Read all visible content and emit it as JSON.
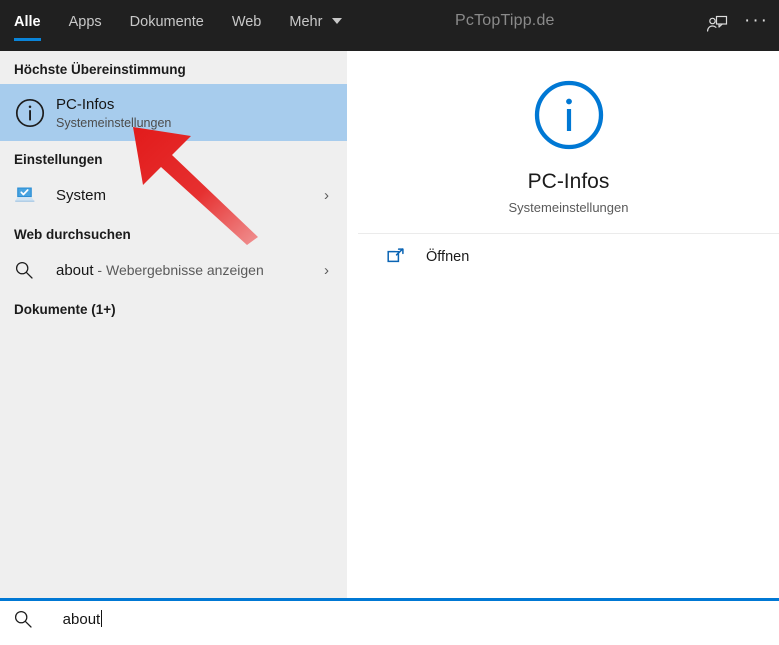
{
  "window": {
    "watermark": "PcTopTipp.de"
  },
  "topbar": {
    "tabs": [
      {
        "label": "Alle",
        "active": true
      },
      {
        "label": "Apps",
        "active": false
      },
      {
        "label": "Dokumente",
        "active": false
      },
      {
        "label": "Web",
        "active": false
      },
      {
        "label": "Mehr",
        "active": false,
        "has_caret": true
      }
    ],
    "feedback_icon": "person-feedback-icon",
    "more_icon": "ellipsis-icon",
    "background_color": "#202020",
    "accent_color": "#0a84d8"
  },
  "sidebar": {
    "best_match_header": "Höchste Übereinstimmung",
    "best_match": {
      "title": "PC-Infos",
      "subtitle": "Systemeinstellungen",
      "icon": "info-circle-icon",
      "selected": true,
      "highlight_color": "#a7cced"
    },
    "settings_header": "Einstellungen",
    "settings_items": [
      {
        "label": "System",
        "icon": "system-monitor-icon",
        "chevron": "›"
      }
    ],
    "web_header": "Web durchsuchen",
    "web_items": [
      {
        "query": "about",
        "suffix": " - Webergebnisse anzeigen",
        "icon": "search-icon",
        "chevron": "›"
      }
    ],
    "documents_header": "Dokumente (1+)",
    "background_color": "#efefef"
  },
  "detail": {
    "icon": "info-circle-icon-large",
    "icon_color": "#0078d4",
    "title": "PC-Infos",
    "subtitle": "Systemeinstellungen",
    "actions": [
      {
        "label": "Öffnen",
        "icon": "open-external-icon"
      }
    ]
  },
  "search": {
    "icon": "search-icon",
    "value": "about",
    "border_color": "#0078d4"
  },
  "annotation": {
    "arrow_color": "#e8201f",
    "type": "red-arrow-pointer",
    "points_to": "best-match-result"
  }
}
